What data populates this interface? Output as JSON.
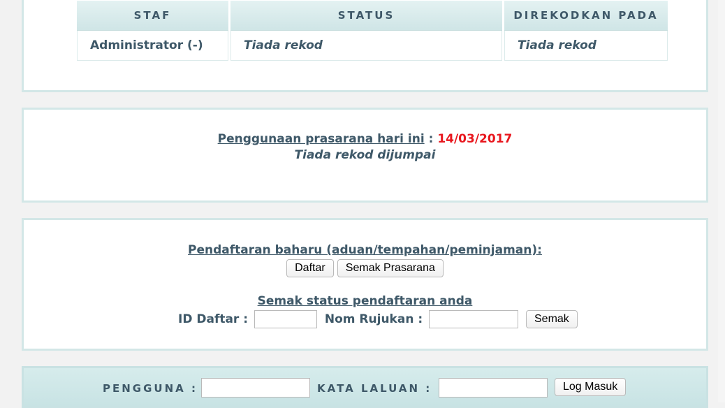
{
  "staff_table": {
    "headers": [
      "STAF",
      "STATUS",
      "DIREKODKAN PADA"
    ],
    "row": {
      "staff": "Administrator (-)",
      "status": "Tiada rekod",
      "recorded_at": "Tiada rekod"
    }
  },
  "usage": {
    "label": "Penggunaan prasarana hari ini",
    "separator": ":",
    "date": "14/03/2017",
    "empty_message": "Tiada rekod dijumpai"
  },
  "registration": {
    "heading": "Pendaftaran baharu (aduan/tempahan/peminjaman):",
    "register_button": "Daftar",
    "check_facility_button": "Semak Prasarana",
    "status_heading": "Semak status pendaftaran anda",
    "id_label": "ID Daftar :",
    "reference_label": "Nom Rujukan :",
    "id_value": "",
    "reference_value": "",
    "check_button": "Semak"
  },
  "login": {
    "user_label": "PENGGUNA :",
    "password_label": "KATA LALUAN :",
    "user_value": "",
    "password_value": "",
    "login_button": "Log Masuk"
  }
}
